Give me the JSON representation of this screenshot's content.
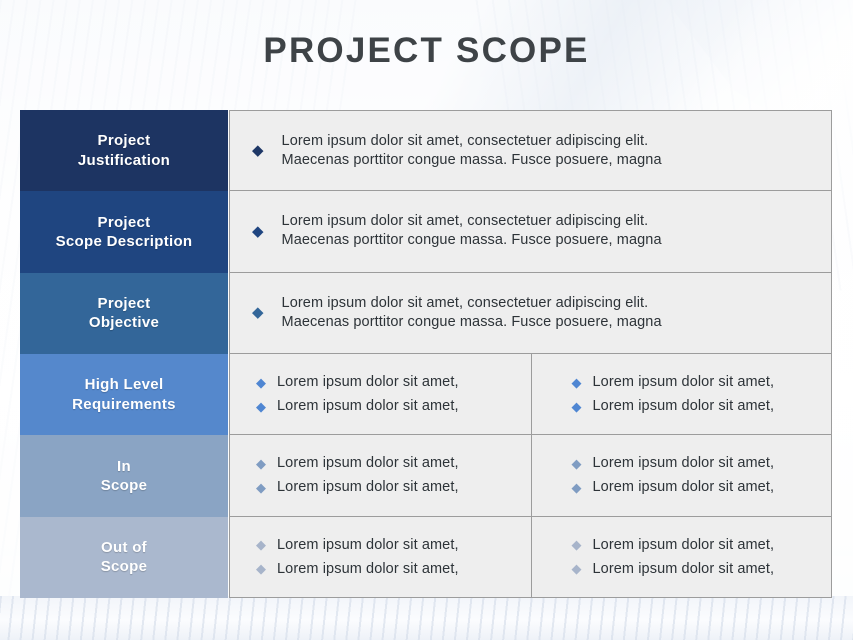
{
  "slide": {
    "title": "PROJECT SCOPE",
    "title_color": "#3e4347",
    "background_color": "#fbfcfd",
    "cell_background": "#eeeeee",
    "cell_border_color": "#9c9c9c"
  },
  "bullet_icon": "diamond-bullet",
  "rows": [
    {
      "label": "Project\nJustification",
      "label_line1": "Project",
      "label_line2": "Justification",
      "color": "#1d3462",
      "bullet_color": "#1e3766",
      "layout": "paragraph",
      "paragraph": "Lorem ipsum dolor sit amet, consectetuer adipiscing elit. Maecenas porttitor congue massa. Fusce posuere, magna",
      "paragraph_line1": "Lorem ipsum dolor sit amet, consectetuer adipiscing elit.",
      "paragraph_line2": "Maecenas porttitor congue massa. Fusce posuere, magna"
    },
    {
      "label": "Project\nScope Description",
      "label_line1": "Project",
      "label_line2": "Scope Description",
      "color": "#1f4580",
      "bullet_color": "#1f4580",
      "layout": "paragraph",
      "paragraph": "Lorem ipsum dolor sit amet, consectetuer adipiscing elit. Maecenas porttitor congue massa. Fusce posuere, magna",
      "paragraph_line1": "Lorem ipsum dolor sit amet, consectetuer adipiscing elit.",
      "paragraph_line2": "Maecenas porttitor congue massa. Fusce posuere, magna"
    },
    {
      "label": "Project\nObjective",
      "label_line1": "Project",
      "label_line2": "Objective",
      "color": "#336699",
      "bullet_color": "#336699",
      "layout": "paragraph",
      "paragraph": "Lorem ipsum dolor sit amet, consectetuer adipiscing elit. Maecenas porttitor congue massa. Fusce posuere, magna",
      "paragraph_line1": "Lorem ipsum dolor sit amet, consectetuer adipiscing elit.",
      "paragraph_line2": "Maecenas porttitor congue massa. Fusce posuere, magna"
    },
    {
      "label": "High Level\nRequirements",
      "label_line1": "High Level",
      "label_line2": "Requirements",
      "color": "#5588cc",
      "bullet_color": "#4f86d2",
      "layout": "two-column",
      "left_items": [
        "Lorem ipsum dolor sit amet,",
        "Lorem ipsum dolor sit amet,"
      ],
      "right_items": [
        "Lorem ipsum dolor sit amet,",
        "Lorem ipsum dolor sit amet,"
      ]
    },
    {
      "label": "In\nScope",
      "label_line1": "In",
      "label_line2": "Scope",
      "color": "#8aa4c4",
      "bullet_color": "#7f9cc2",
      "layout": "two-column",
      "left_items": [
        "Lorem ipsum dolor sit amet,",
        "Lorem ipsum dolor sit amet,"
      ],
      "right_items": [
        "Lorem ipsum dolor sit amet,",
        "Lorem ipsum dolor sit amet,"
      ]
    },
    {
      "label": "Out of\nScope",
      "label_line1": "Out of",
      "label_line2": "Scope",
      "color": "#aab8ce",
      "bullet_color": "#a7b4ca",
      "layout": "two-column",
      "left_items": [
        "Lorem ipsum dolor sit amet,",
        "Lorem ipsum dolor sit amet,"
      ],
      "right_items": [
        "Lorem ipsum dolor sit amet,",
        "Lorem ipsum dolor sit amet,"
      ]
    }
  ]
}
